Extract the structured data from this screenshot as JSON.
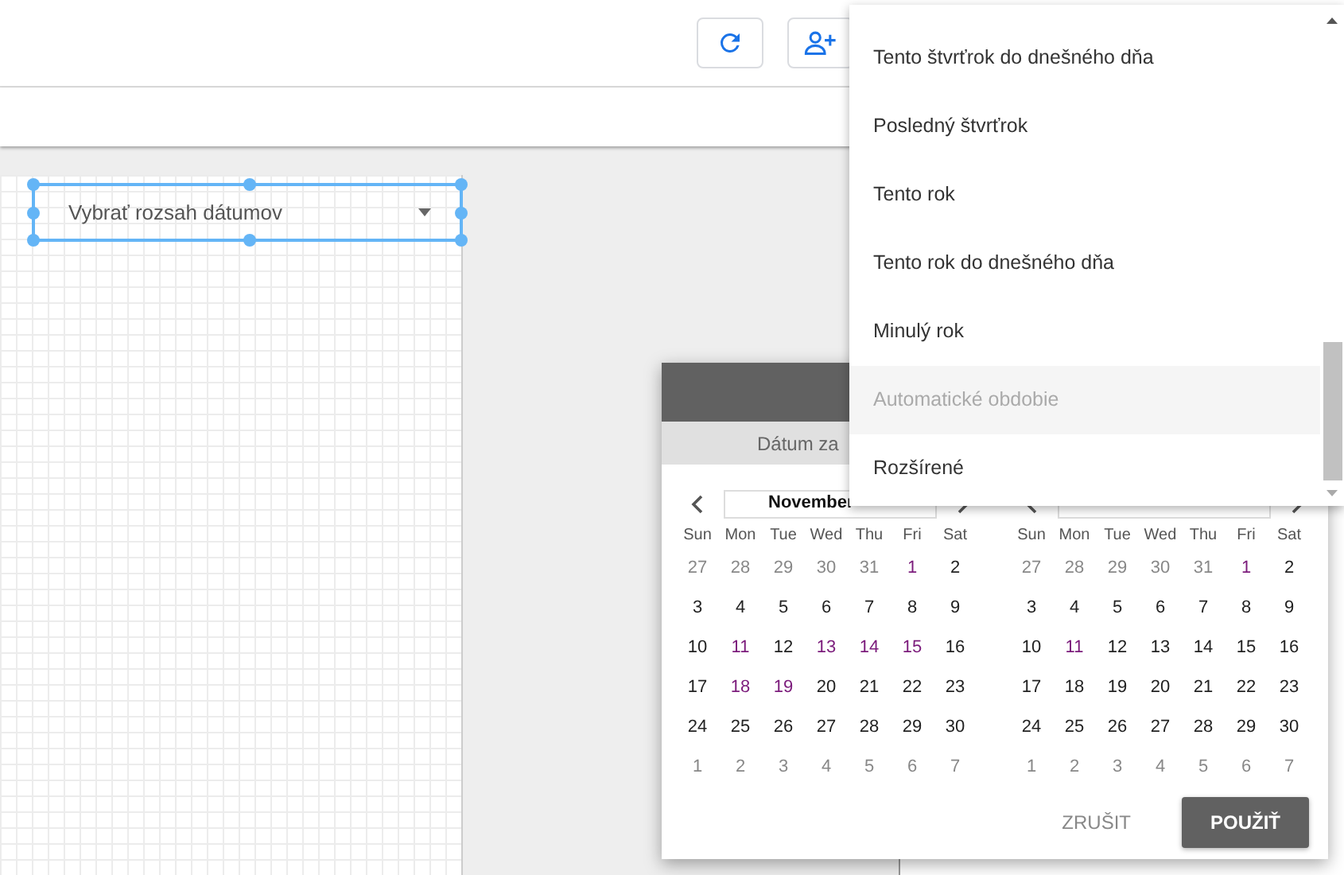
{
  "date_control": {
    "placeholder": "Vybrať rozsah dátumov"
  },
  "dialog": {
    "subheader": "Dátum za",
    "calendars": [
      {
        "month": "November",
        "weekdays": [
          "Sun",
          "Mon",
          "Tue",
          "Wed",
          "Thu",
          "Fri",
          "Sat"
        ],
        "weeks": [
          [
            {
              "d": "27",
              "kind": "other"
            },
            {
              "d": "28",
              "kind": "other"
            },
            {
              "d": "29",
              "kind": "other"
            },
            {
              "d": "30",
              "kind": "other"
            },
            {
              "d": "31",
              "kind": "other"
            },
            {
              "d": "1",
              "kind": "visited"
            },
            {
              "d": "2",
              "kind": "day"
            }
          ],
          [
            {
              "d": "3",
              "kind": "day"
            },
            {
              "d": "4",
              "kind": "day"
            },
            {
              "d": "5",
              "kind": "day"
            },
            {
              "d": "6",
              "kind": "day"
            },
            {
              "d": "7",
              "kind": "day"
            },
            {
              "d": "8",
              "kind": "day"
            },
            {
              "d": "9",
              "kind": "day"
            }
          ],
          [
            {
              "d": "10",
              "kind": "day"
            },
            {
              "d": "11",
              "kind": "visited"
            },
            {
              "d": "12",
              "kind": "day"
            },
            {
              "d": "13",
              "kind": "visited"
            },
            {
              "d": "14",
              "kind": "visited"
            },
            {
              "d": "15",
              "kind": "visited"
            },
            {
              "d": "16",
              "kind": "day"
            }
          ],
          [
            {
              "d": "17",
              "kind": "day"
            },
            {
              "d": "18",
              "kind": "visited"
            },
            {
              "d": "19",
              "kind": "visited"
            },
            {
              "d": "20",
              "kind": "day"
            },
            {
              "d": "21",
              "kind": "day"
            },
            {
              "d": "22",
              "kind": "day"
            },
            {
              "d": "23",
              "kind": "day"
            }
          ],
          [
            {
              "d": "24",
              "kind": "day"
            },
            {
              "d": "25",
              "kind": "day"
            },
            {
              "d": "26",
              "kind": "day"
            },
            {
              "d": "27",
              "kind": "day"
            },
            {
              "d": "28",
              "kind": "day"
            },
            {
              "d": "29",
              "kind": "day"
            },
            {
              "d": "30",
              "kind": "day"
            }
          ],
          [
            {
              "d": "1",
              "kind": "other"
            },
            {
              "d": "2",
              "kind": "other"
            },
            {
              "d": "3",
              "kind": "other"
            },
            {
              "d": "4",
              "kind": "other"
            },
            {
              "d": "5",
              "kind": "other"
            },
            {
              "d": "6",
              "kind": "other"
            },
            {
              "d": "7",
              "kind": "other"
            }
          ]
        ]
      },
      {
        "weekdays": [
          "Sun",
          "Mon",
          "Tue",
          "Wed",
          "Thu",
          "Fri",
          "Sat"
        ],
        "weeks": [
          [
            {
              "d": "27",
              "kind": "other"
            },
            {
              "d": "28",
              "kind": "other"
            },
            {
              "d": "29",
              "kind": "other"
            },
            {
              "d": "30",
              "kind": "other"
            },
            {
              "d": "31",
              "kind": "other"
            },
            {
              "d": "1",
              "kind": "visited"
            },
            {
              "d": "2",
              "kind": "day"
            }
          ],
          [
            {
              "d": "3",
              "kind": "day"
            },
            {
              "d": "4",
              "kind": "day"
            },
            {
              "d": "5",
              "kind": "day"
            },
            {
              "d": "6",
              "kind": "day"
            },
            {
              "d": "7",
              "kind": "day"
            },
            {
              "d": "8",
              "kind": "day"
            },
            {
              "d": "9",
              "kind": "day"
            }
          ],
          [
            {
              "d": "10",
              "kind": "day"
            },
            {
              "d": "11",
              "kind": "visited"
            },
            {
              "d": "12",
              "kind": "day"
            },
            {
              "d": "13",
              "kind": "day"
            },
            {
              "d": "14",
              "kind": "day"
            },
            {
              "d": "15",
              "kind": "day"
            },
            {
              "d": "16",
              "kind": "day"
            }
          ],
          [
            {
              "d": "17",
              "kind": "day"
            },
            {
              "d": "18",
              "kind": "day"
            },
            {
              "d": "19",
              "kind": "day"
            },
            {
              "d": "20",
              "kind": "day"
            },
            {
              "d": "21",
              "kind": "day"
            },
            {
              "d": "22",
              "kind": "day"
            },
            {
              "d": "23",
              "kind": "day"
            }
          ],
          [
            {
              "d": "24",
              "kind": "day"
            },
            {
              "d": "25",
              "kind": "day"
            },
            {
              "d": "26",
              "kind": "day"
            },
            {
              "d": "27",
              "kind": "day"
            },
            {
              "d": "28",
              "kind": "day"
            },
            {
              "d": "29",
              "kind": "day"
            },
            {
              "d": "30",
              "kind": "day"
            }
          ],
          [
            {
              "d": "1",
              "kind": "other"
            },
            {
              "d": "2",
              "kind": "other"
            },
            {
              "d": "3",
              "kind": "other"
            },
            {
              "d": "4",
              "kind": "other"
            },
            {
              "d": "5",
              "kind": "other"
            },
            {
              "d": "6",
              "kind": "other"
            },
            {
              "d": "7",
              "kind": "other"
            }
          ]
        ]
      }
    ],
    "buttons": [
      {
        "label": "ZRUŠIT",
        "kind": "text"
      },
      {
        "label": "POUŽIŤ",
        "kind": "raised"
      }
    ]
  },
  "dropdown": {
    "items": [
      {
        "label": "Tento štvrťrok do dnešného dňa",
        "disabled": false
      },
      {
        "label": "Posledný štvrťrok",
        "disabled": false
      },
      {
        "label": "Tento rok",
        "disabled": false
      },
      {
        "label": "Tento rok do dnešného dňa",
        "disabled": false
      },
      {
        "label": "Minulý rok",
        "disabled": false
      },
      {
        "label": "Automatické obdobie",
        "disabled": true
      },
      {
        "label": "Rozšírené",
        "disabled": false
      }
    ]
  }
}
